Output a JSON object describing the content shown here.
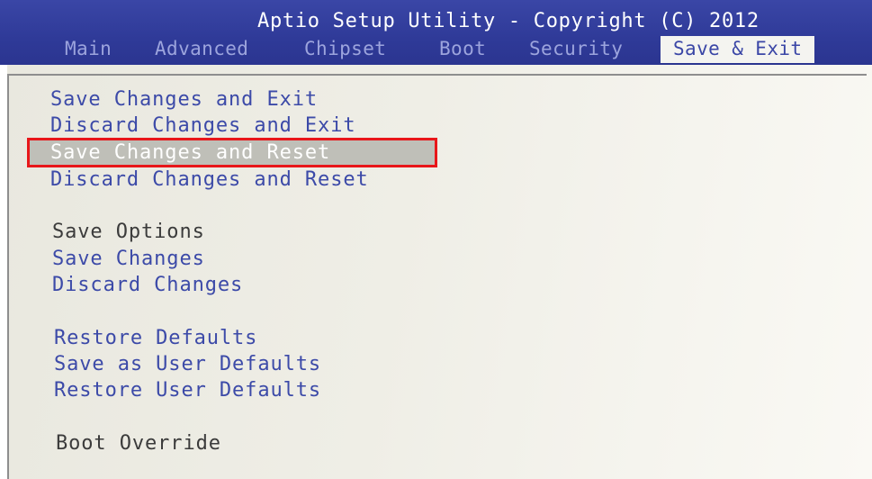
{
  "header": {
    "title": "Aptio Setup Utility - Copyright (C) 2012 ",
    "tabs": [
      {
        "label": "Main"
      },
      {
        "label": "Advanced"
      },
      {
        "label": "Chipset"
      },
      {
        "label": "Boot"
      },
      {
        "label": "Security"
      },
      {
        "label": "Save & Exit",
        "active": true
      }
    ]
  },
  "menu": {
    "items": [
      {
        "label": "Save Changes and Exit"
      },
      {
        "label": "Discard Changes and Exit"
      },
      {
        "label": "Save Changes and Reset",
        "selected": true
      },
      {
        "label": "Discard Changes and Reset"
      },
      {
        "label": "Save Options"
      },
      {
        "label": "Save Changes"
      },
      {
        "label": "Discard Changes"
      },
      {
        "label": "Restore Defaults"
      },
      {
        "label": "Save as User Defaults"
      },
      {
        "label": "Restore User Defaults"
      },
      {
        "label": "Boot Override"
      }
    ]
  },
  "colors": {
    "header_bg": "#2f3a98",
    "item_text": "#3c4aa8",
    "selection_outline": "#e8161a"
  }
}
